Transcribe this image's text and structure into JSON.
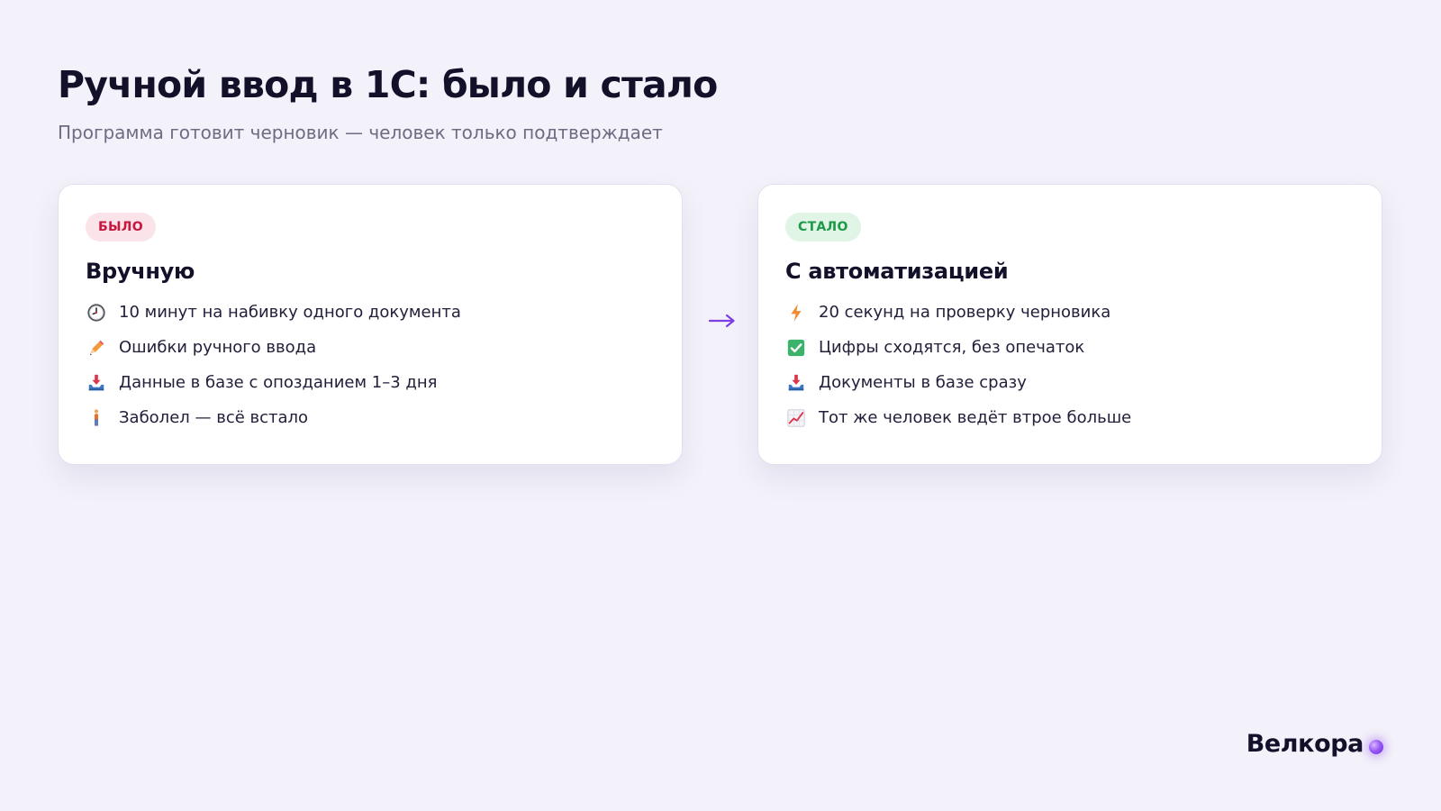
{
  "slide": {
    "title": "Ручной ввод в 1С: было и стало",
    "subtitle": "Программа готовит черновик — человек только подтверждает",
    "arrow_glyph": "→",
    "brand": "Велкора"
  },
  "before": {
    "tag": "БЫЛО",
    "tag_color": "#c8163f",
    "heading": "Вручную",
    "items": [
      {
        "icon": "clock-icon",
        "text": "10 минут на набивку одного документа"
      },
      {
        "icon": "pencil-icon",
        "text": "Ошибки ручного ввода"
      },
      {
        "icon": "inbox-tray-icon",
        "text": "Данные в базе с опозданием 1–3 дня"
      },
      {
        "icon": "person-standing-icon",
        "text": "Заболел — всё встало"
      }
    ]
  },
  "after": {
    "tag": "СТАЛО",
    "tag_color": "#1d9a48",
    "heading": "С автоматизацией",
    "items": [
      {
        "icon": "lightning-icon",
        "text": "20 секунд на проверку черновика"
      },
      {
        "icon": "check-box-icon",
        "text": "Цифры сходятся, без опечаток"
      },
      {
        "icon": "inbox-tray-icon",
        "text": "Документы в базе сразу"
      },
      {
        "icon": "chart-increasing-icon",
        "text": "Тот же человек ведёт втрое больше"
      }
    ]
  },
  "colors": {
    "background": "#f3f1f9",
    "accent_purple": "#7b3fe4",
    "text_dark": "#13112a",
    "text_muted": "#6f6b82"
  }
}
